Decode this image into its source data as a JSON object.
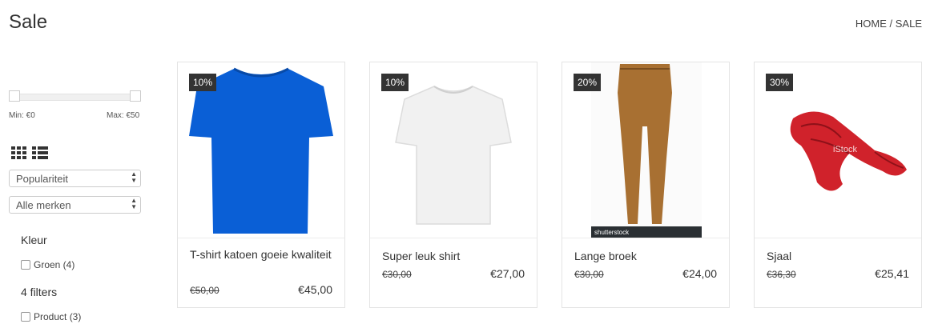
{
  "page": {
    "title": "Sale"
  },
  "breadcrumb": {
    "home": "HOME",
    "separator": " / ",
    "current": "SALE"
  },
  "price_filter": {
    "min_label": "Min: €0",
    "max_label": "Max: €50",
    "min_fraction": 0.0,
    "max_fraction": 1.0
  },
  "view_toggle": {
    "grid_icon": "grid-view-icon",
    "list_icon": "list-view-icon"
  },
  "sort_select": {
    "value": "Populariteit"
  },
  "brand_select": {
    "value": "Alle merken"
  },
  "filters": {
    "kleur_heading": "Kleur",
    "kleur_options": [
      {
        "label": "Groen (4)",
        "checked": false
      }
    ],
    "filters_heading": "4 filters",
    "filters_options": [
      {
        "label": "Product (3)",
        "checked": false
      }
    ]
  },
  "products": [
    {
      "badge": "10%",
      "name": "T-shirt katoen goeie kwaliteit",
      "old_price": "€50,00",
      "new_price": "€45,00",
      "image": "blue-tshirt",
      "color": "#0a5fd6"
    },
    {
      "badge": "10%",
      "name": "Super leuk shirt",
      "old_price": "€30,00",
      "new_price": "€27,00",
      "image": "white-tshirt",
      "color": "#f2f2f2"
    },
    {
      "badge": "20%",
      "name": "Lange broek",
      "old_price": "€30,00",
      "new_price": "€24,00",
      "image": "brown-trousers",
      "color": "#a87032",
      "watermark": "shutterstock"
    },
    {
      "badge": "30%",
      "name": "Sjaal",
      "old_price": "€36,30",
      "new_price": "€25,41",
      "image": "red-scarf",
      "color": "#d0222b",
      "watermark": "iStock"
    }
  ]
}
